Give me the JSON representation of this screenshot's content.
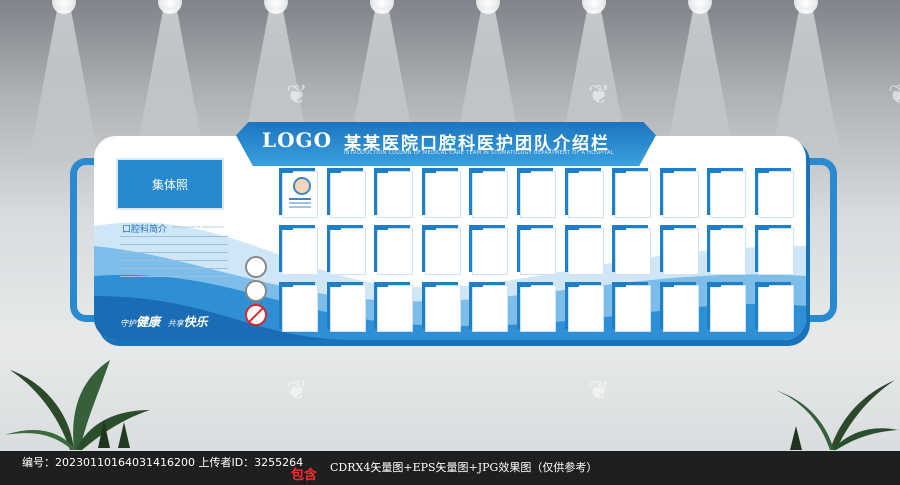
{
  "header": {
    "logo": "LOGO",
    "title": "某某医院口腔科医护团队介绍栏",
    "subtitle": "INTRODUCTION COLUMN OF MEDICAL CARE TEAM IN STOMATOLOGY DEPARTMENT OF A HOSPITAL"
  },
  "left_panel": {
    "group_photo": "集体照",
    "intro_title": "口腔科简介",
    "intro_sub": "INTRODUCTION OF STOMATOLOGY",
    "slogan_prefix_1": "守护",
    "slogan_word_1": "健康",
    "slogan_prefix_2": "共享",
    "slogan_word_2": "快乐"
  },
  "grid": {
    "rows": 3,
    "cols": 11
  },
  "colors": {
    "accent": "#1e7fc8",
    "header_dark": "#1c75bf",
    "footer_bg": "#1d1f21"
  },
  "footer": {
    "left_text": "编号：20230110164031416200 上传者ID：3255264",
    "badge": "包含",
    "right_text": "CDRX4矢量图+EPS矢量图+JPG效果图（仅供参考）"
  }
}
